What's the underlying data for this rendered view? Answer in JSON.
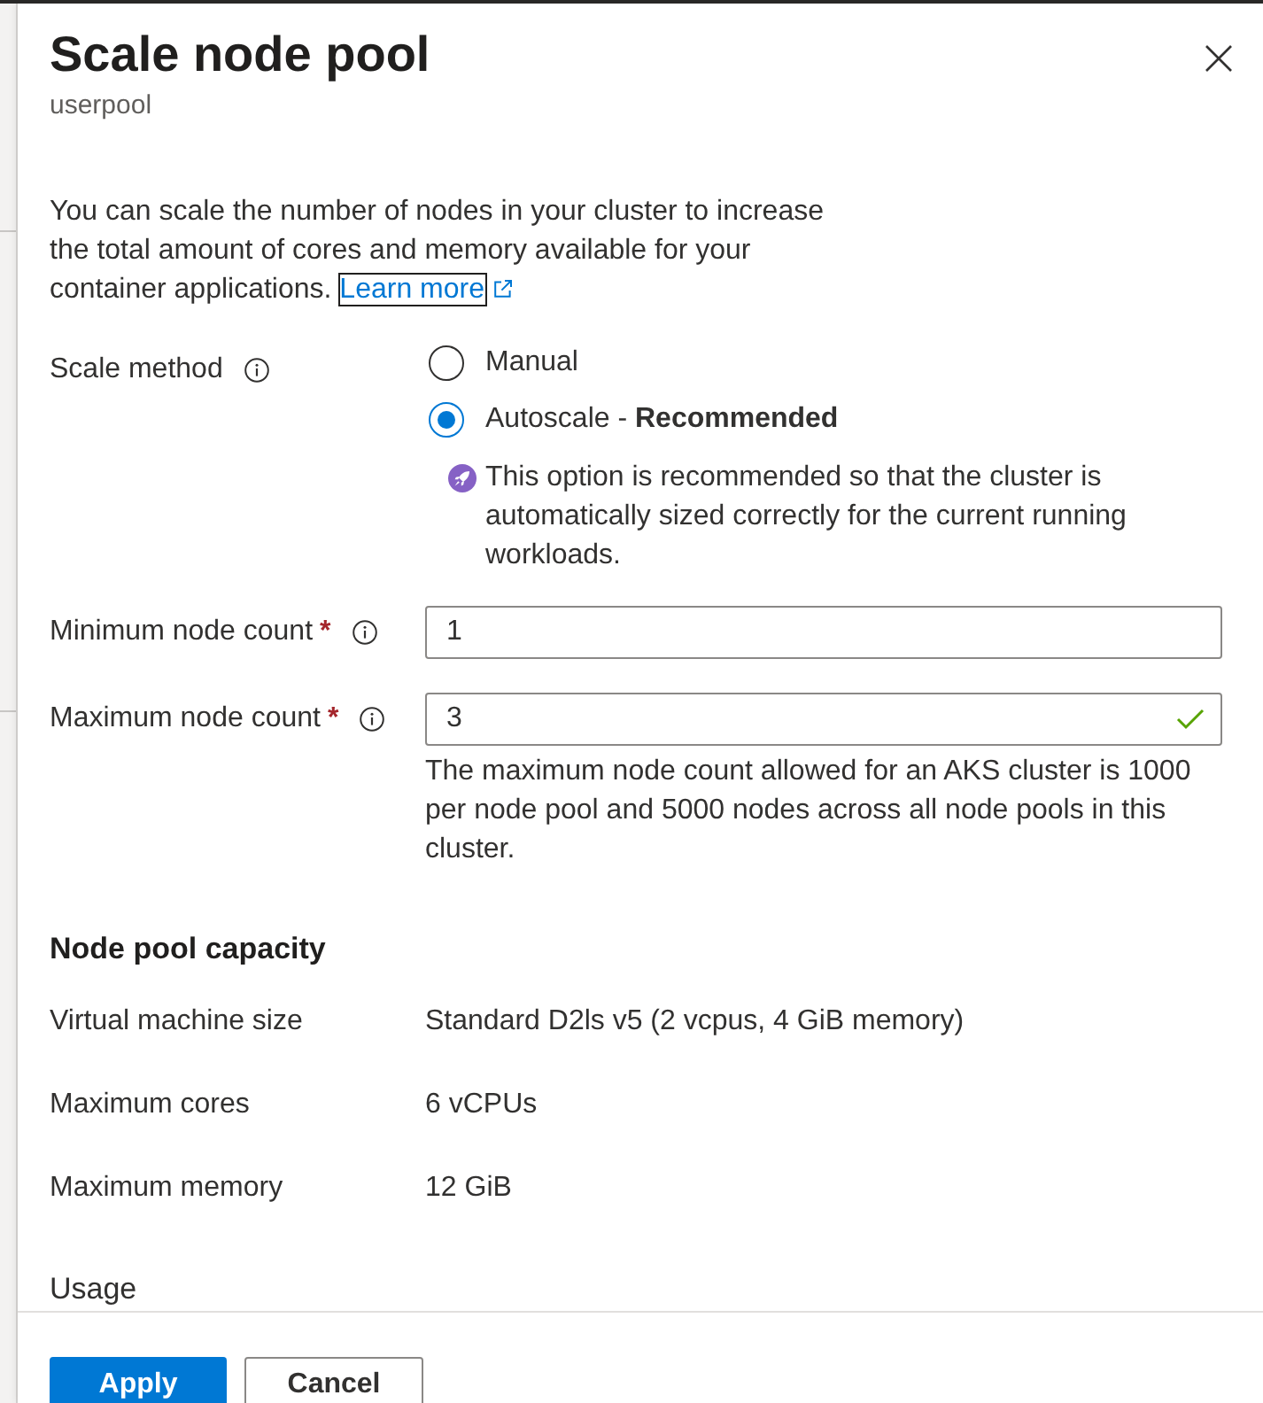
{
  "panel": {
    "title": "Scale node pool",
    "subtitle": "userpool"
  },
  "description": {
    "text": "You can scale the number of nodes in your cluster to increase the total amount of cores and memory available for your container applications.",
    "link": {
      "label": "Learn more",
      "focused": true
    }
  },
  "scale_method": {
    "label": "Scale method",
    "options": [
      {
        "label": "Manual",
        "selected": false
      },
      {
        "label": "Autoscale - **Recommended**",
        "selected": true
      }
    ],
    "note": "This option is recommended so that the cluster is automatically sized correctly for the current running workloads."
  },
  "fields": [
    {
      "label": "Minimum node count",
      "required_mark": "*",
      "value": "1",
      "valid": false
    },
    {
      "label": "Maximum node count",
      "required_mark": "*",
      "value": "3",
      "valid": true,
      "help": "The maximum node count allowed for an AKS cluster is 1000 per node pool and 5000 nodes across all node pools in this cluster."
    }
  ],
  "capacity": {
    "title": "Node pool capacity",
    "rows": [
      {
        "label": "Virtual machine size",
        "value": "Standard D2ls v5 (2 vcpus, 4 GiB memory)"
      },
      {
        "label": "Maximum cores",
        "value": "6 vCPUs"
      },
      {
        "label": "Maximum memory",
        "value": "12 GiB"
      }
    ]
  },
  "usage": {
    "title": "Usage"
  },
  "buttons": [
    {
      "label": "Apply",
      "kind": "primary"
    },
    {
      "label": "Cancel",
      "kind": "secondary"
    }
  ]
}
